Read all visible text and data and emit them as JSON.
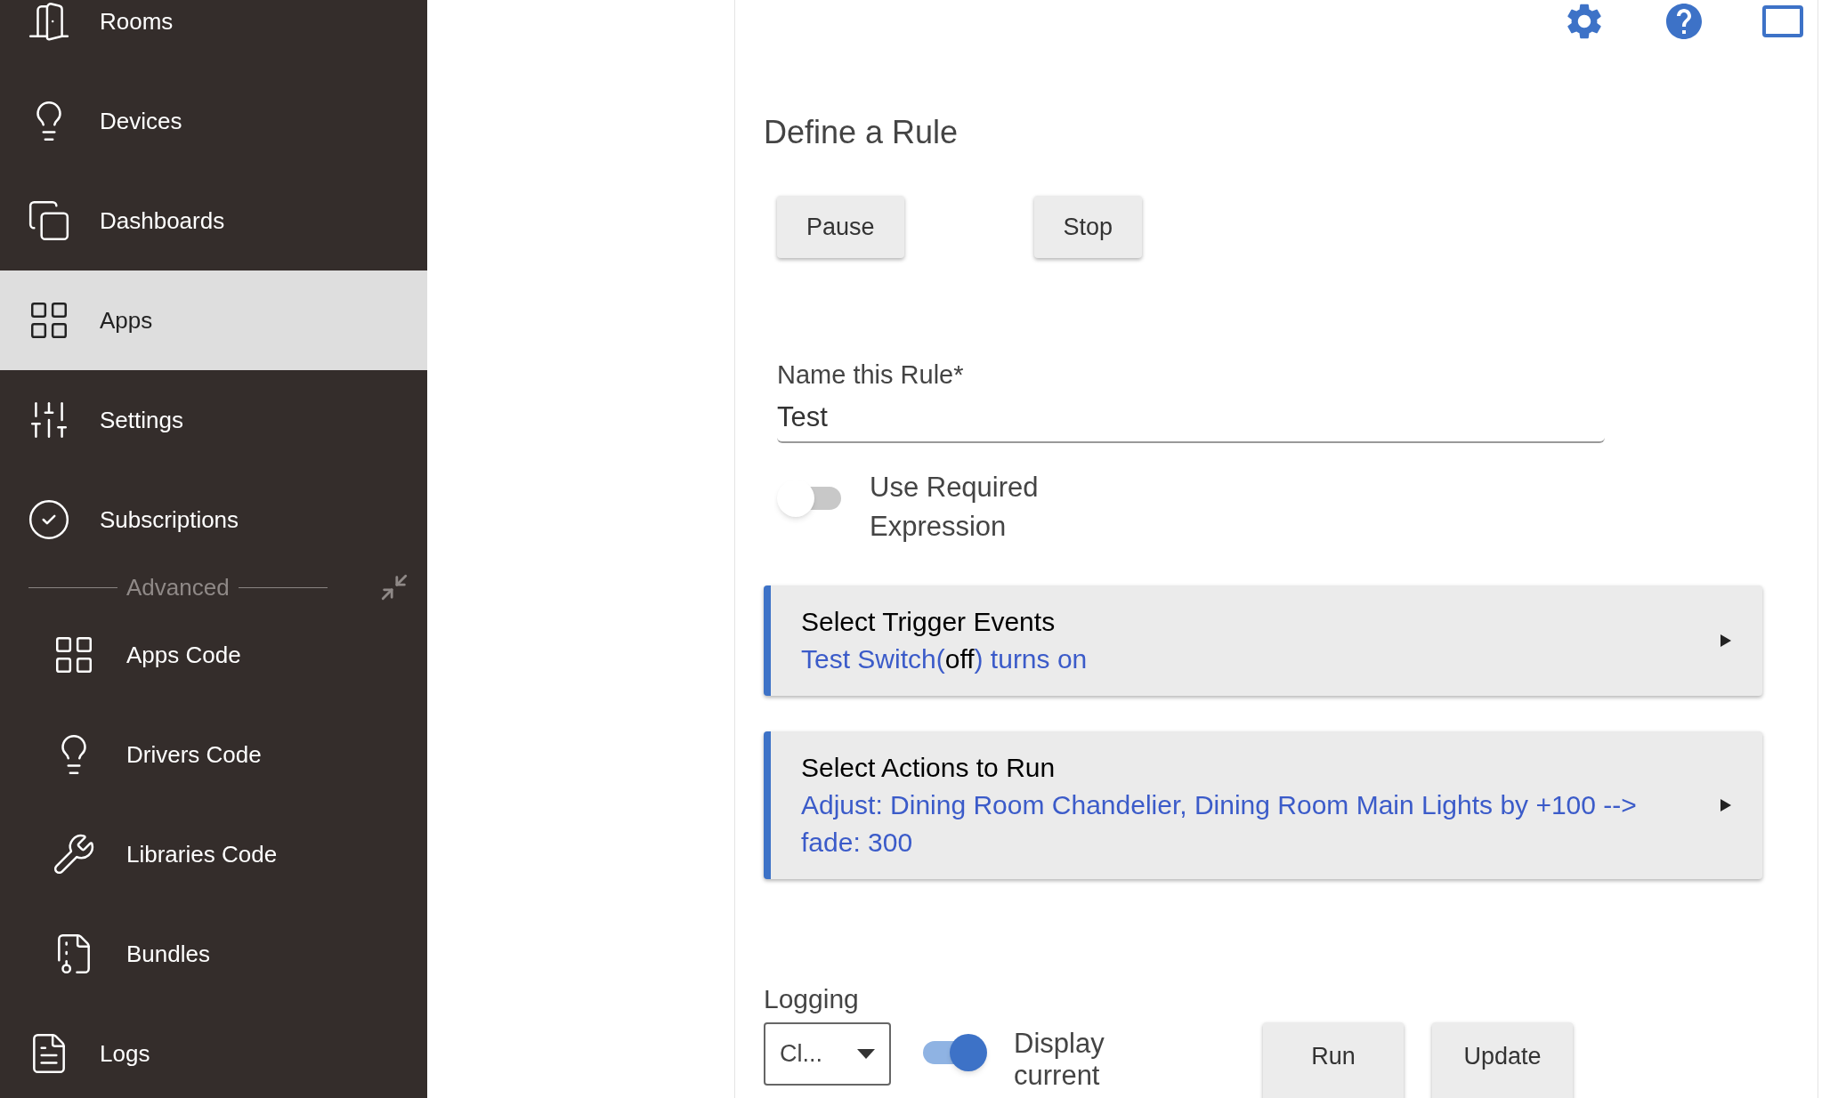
{
  "sidebar": {
    "items": [
      {
        "label": "Rooms",
        "selected": false
      },
      {
        "label": "Devices",
        "selected": false
      },
      {
        "label": "Dashboards",
        "selected": false
      },
      {
        "label": "Apps",
        "selected": true
      },
      {
        "label": "Settings",
        "selected": false
      },
      {
        "label": "Subscriptions",
        "selected": false
      }
    ],
    "section_label": "Advanced",
    "sub_items": [
      {
        "label": "Apps Code",
        "selected": false
      },
      {
        "label": "Drivers Code",
        "selected": false
      },
      {
        "label": "Libraries Code",
        "selected": false
      },
      {
        "label": "Bundles",
        "selected": false
      }
    ],
    "footer_items": [
      {
        "label": "Logs",
        "selected": false
      }
    ]
  },
  "page": {
    "title": "Define a Rule",
    "top_buttons": [
      "Pause",
      "Stop"
    ],
    "name_field": {
      "label": "Name this Rule*",
      "value": "Test"
    },
    "required_expression": {
      "label": "Use Required Expression",
      "on": false
    },
    "sections": [
      {
        "title": "Select Trigger Events",
        "summary": [
          {
            "text": "Test Switch(",
            "kind": "link"
          },
          {
            "text": "off",
            "kind": "plain"
          },
          {
            "text": ") turns on",
            "kind": "link"
          }
        ]
      },
      {
        "title": "Select Actions to Run",
        "summary": [
          {
            "text": "Adjust: Dining Room Chandelier, Dining Room Main Lights by +100 --> fade: 300",
            "kind": "link"
          }
        ]
      }
    ],
    "logging": {
      "label": "Logging",
      "value": "Cl..."
    },
    "display_current": {
      "label": "Display current",
      "on": true
    },
    "bottom_buttons": [
      "Run",
      "Update"
    ]
  }
}
